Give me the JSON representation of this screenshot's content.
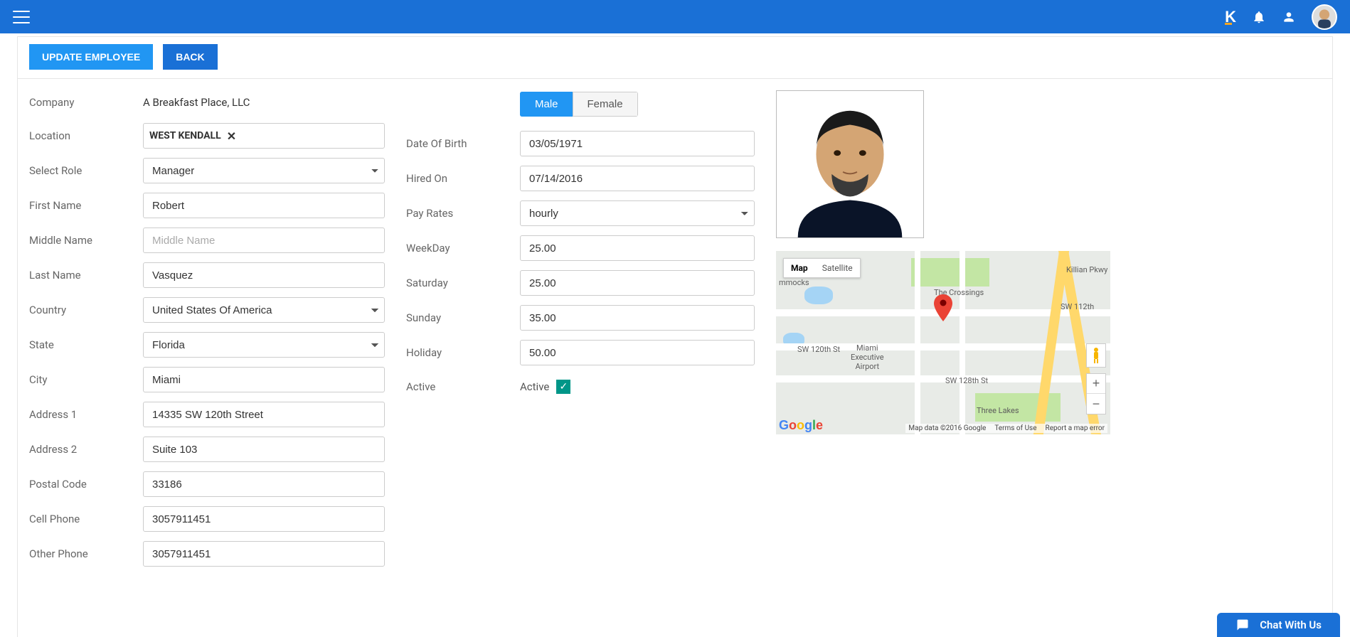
{
  "buttons": {
    "update": "UPDATE EMPLOYEE",
    "back": "BACK"
  },
  "labels": {
    "company": "Company",
    "location": "Location",
    "role": "Select Role",
    "firstName": "First Name",
    "middleName": "Middle Name",
    "lastName": "Last Name",
    "country": "Country",
    "state": "State",
    "city": "City",
    "address1": "Address 1",
    "address2": "Address 2",
    "postalCode": "Postal Code",
    "cellPhone": "Cell Phone",
    "otherPhone": "Other Phone",
    "dob": "Date Of Birth",
    "hiredOn": "Hired On",
    "payRates": "Pay Rates",
    "weekday": "WeekDay",
    "saturday": "Saturday",
    "sunday": "Sunday",
    "holiday": "Holiday",
    "active": "Active"
  },
  "values": {
    "company": "A Breakfast Place, LLC",
    "locationChip": "WEST KENDALL",
    "role": "Manager",
    "firstName": "Robert",
    "middleName": "",
    "middleNamePlaceholder": "Middle Name",
    "lastName": "Vasquez",
    "country": "United States Of America",
    "state": "Florida",
    "city": "Miami",
    "address1": "14335 SW 120th Street",
    "address2": "Suite 103",
    "postalCode": "33186",
    "cellPhone": "3057911451",
    "otherPhone": "3057911451",
    "dob": "03/05/1971",
    "hiredOn": "07/14/2016",
    "payRates": "hourly",
    "weekday": "25.00",
    "saturday": "25.00",
    "sunday": "35.00",
    "holiday": "50.00",
    "activeLabel": "Active"
  },
  "gender": {
    "male": "Male",
    "female": "Female",
    "selected": "Male"
  },
  "map": {
    "typeMap": "Map",
    "typeSatellite": "Satellite",
    "credits": "Map data ©2016 Google",
    "terms": "Terms of Use",
    "report": "Report a map error",
    "labels": {
      "hammocks": "mmocks",
      "crossings": "The Crossings",
      "threelakes": "Three Lakes",
      "airport": "Miami\nExecutive\nAirport",
      "sw112": "SW 112th",
      "sw120": "SW 120th St",
      "sw128": "SW 128th St",
      "killian": "Killian Pkwy"
    }
  },
  "chat": "Chat With Us"
}
